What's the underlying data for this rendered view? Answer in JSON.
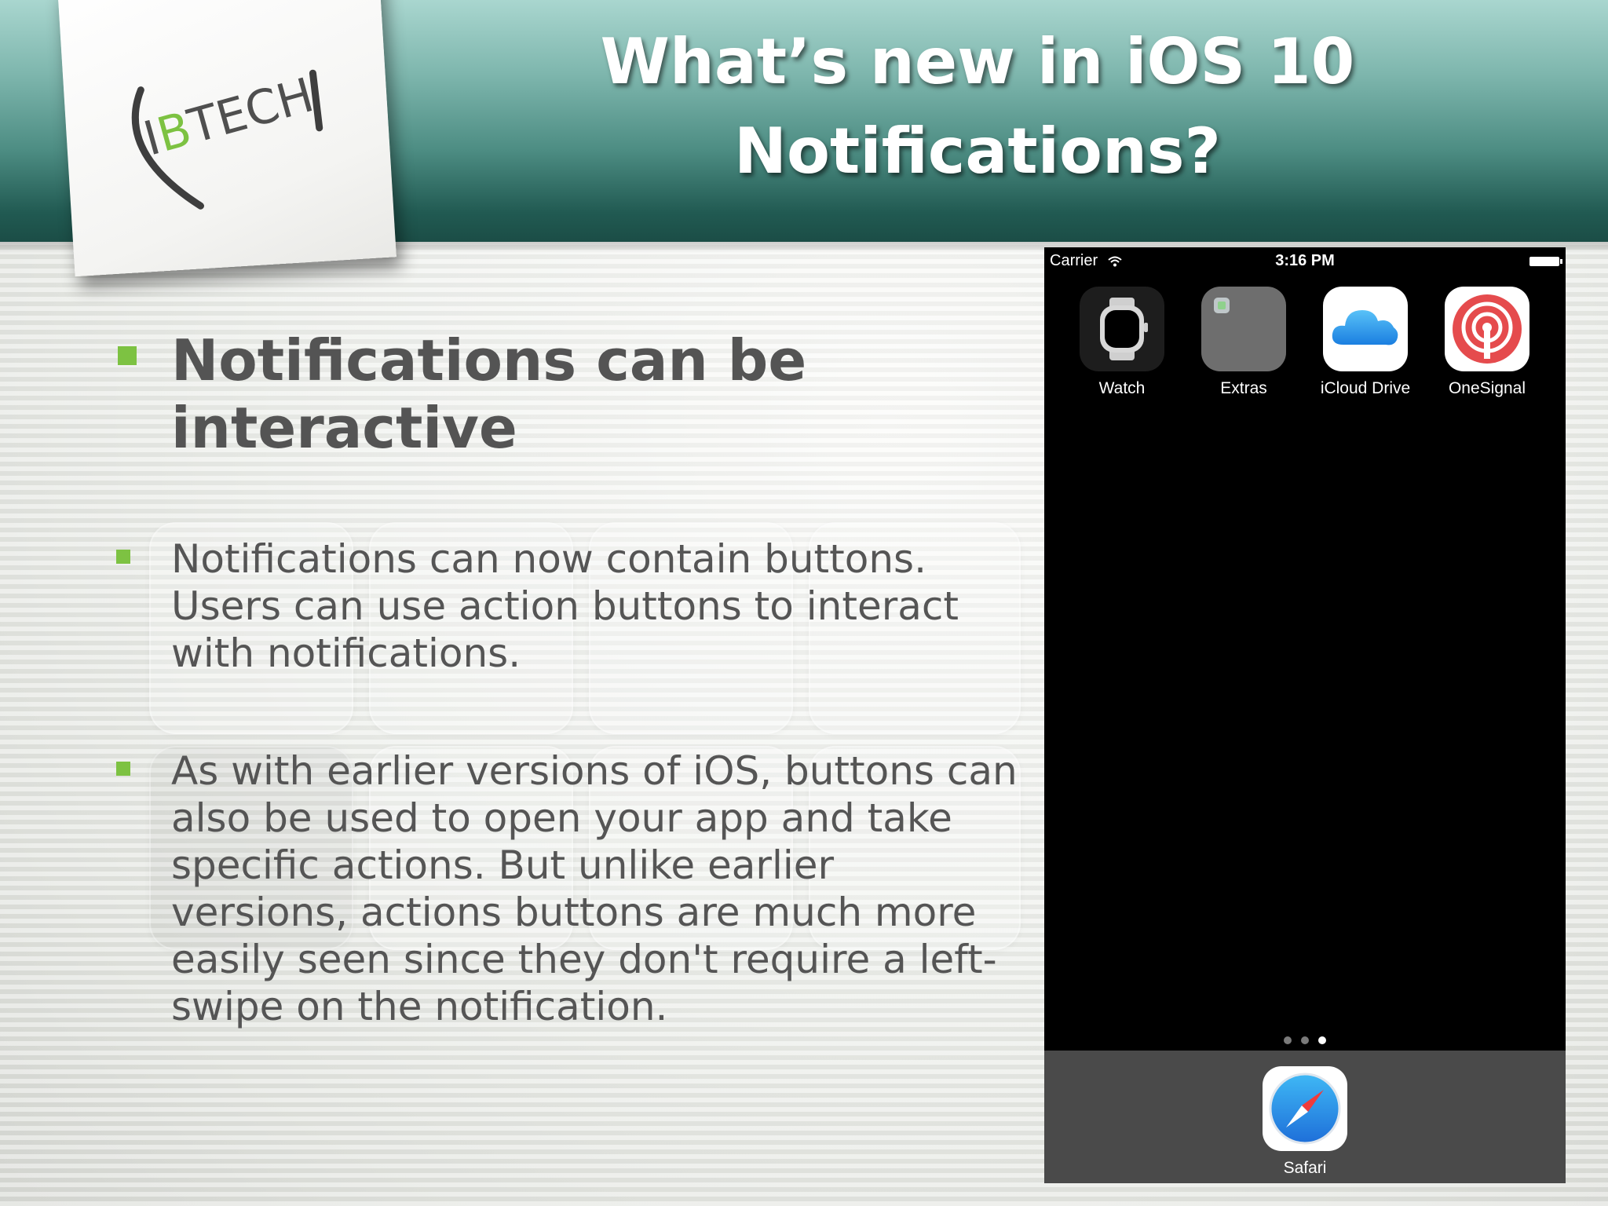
{
  "slide": {
    "title_line1": "What’s new in iOS 10",
    "title_line2": "Notifications?",
    "logo_text": "IBTECH",
    "bullets": [
      "Notifications can be interactive",
      "Notifications can now contain buttons. Users can use action buttons to interact with notifications.",
      "As with earlier versions of iOS, buttons can also be used to open your app and take specific actions. But unlike earlier versions, actions buttons are much more easily seen since they don't require a left-swipe on the notification."
    ]
  },
  "phone": {
    "carrier": "Carrier",
    "time": "3:16 PM",
    "apps": [
      {
        "label": "Watch",
        "icon": "watch-icon"
      },
      {
        "label": "Extras",
        "icon": "folder-icon"
      },
      {
        "label": "iCloud Drive",
        "icon": "cloud-icon"
      },
      {
        "label": "OneSignal",
        "icon": "onesignal-icon"
      }
    ],
    "dock": [
      {
        "label": "Safari",
        "icon": "compass-icon"
      }
    ],
    "page_count": 3,
    "active_page": 3
  },
  "colors": {
    "header_dark": "#1b4d46",
    "header_light": "#a9d6cf",
    "bullet": "#7dc242",
    "body_text": "#555555"
  }
}
